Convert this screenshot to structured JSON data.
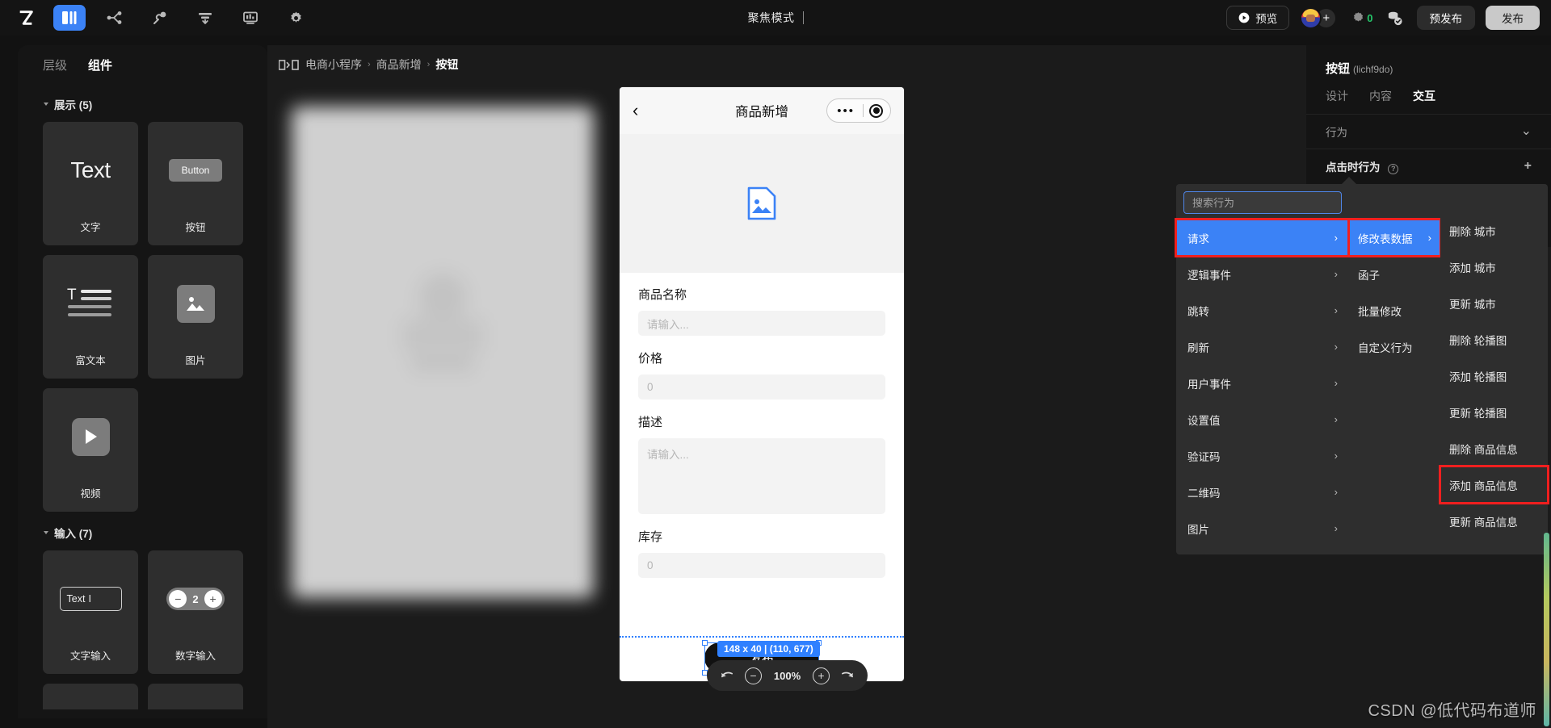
{
  "topbar": {
    "logo": "Z",
    "icons": [
      {
        "name": "pages-icon",
        "active": true
      },
      {
        "name": "flow-icon",
        "active": false
      },
      {
        "name": "plugin-icon",
        "active": false
      },
      {
        "name": "data-table-icon",
        "active": false
      },
      {
        "name": "dashboard-icon",
        "active": false
      },
      {
        "name": "settings-icon",
        "active": false
      }
    ],
    "focus_mode": "聚焦模式",
    "preview_label": "预览",
    "coin_count": "0",
    "prepublish_label": "预发布",
    "publish_label": "发布"
  },
  "left_panel": {
    "tabs": [
      {
        "label": "层级",
        "active": false
      },
      {
        "label": "组件",
        "active": true
      }
    ],
    "groups": [
      {
        "title": "展示 (5)",
        "items": [
          {
            "label": "文字",
            "visual": "Text"
          },
          {
            "label": "按钮",
            "visual": "Button"
          },
          {
            "label": "富文本",
            "visual": "richtext"
          },
          {
            "label": "图片",
            "visual": "image"
          },
          {
            "label": "视频",
            "visual": "video"
          }
        ]
      },
      {
        "title": "输入 (7)",
        "items": [
          {
            "label": "文字输入",
            "visual": "Text"
          },
          {
            "label": "数字输入",
            "visual": "2"
          }
        ]
      }
    ]
  },
  "canvas": {
    "breadcrumb": {
      "icon": "page-flow-icon",
      "parts": [
        "电商小程序",
        "商品新增",
        "按钮"
      ],
      "separator": "›"
    },
    "phone": {
      "nav_title": "商品新增",
      "back_icon": "chevron-left-icon",
      "capsule": {
        "more": "•••",
        "target": "target-icon"
      },
      "image_placeholder_icon": "image-file-icon",
      "fields": [
        {
          "label": "商品名称",
          "placeholder": "请输入...",
          "type": "input"
        },
        {
          "label": "价格",
          "placeholder": "0",
          "type": "input"
        },
        {
          "label": "描述",
          "placeholder": "请输入...",
          "type": "textarea"
        },
        {
          "label": "库存",
          "placeholder": "0",
          "type": "input"
        }
      ],
      "publish_button": "发布"
    },
    "selection_tip": "148 x 40 | (110, 677)",
    "zoom": {
      "undo_icon": "undo-icon",
      "minus": "−",
      "percent": "100%",
      "plus": "+",
      "redo_icon": "redo-icon"
    }
  },
  "right_panel": {
    "component_name": "按钮",
    "component_id": "(lichf9do)",
    "tabs": [
      {
        "label": "设计",
        "active": false
      },
      {
        "label": "内容",
        "active": false
      },
      {
        "label": "交互",
        "active": true
      }
    ],
    "section_label": "行为",
    "section_collapse_icon": "chevron-up-icon",
    "row_label": "点击时行为",
    "row_help_icon": "help-icon",
    "row_add_icon": "+"
  },
  "dropdown": {
    "search_placeholder": "搜索行为",
    "column1": [
      {
        "label": "请求",
        "has_children": true,
        "selected": true,
        "highlighted": true
      },
      {
        "label": "逻辑事件",
        "has_children": true,
        "selected": false,
        "highlighted": false
      },
      {
        "label": "跳转",
        "has_children": true,
        "selected": false,
        "highlighted": false
      },
      {
        "label": "刷新",
        "has_children": true,
        "selected": false,
        "highlighted": false
      },
      {
        "label": "用户事件",
        "has_children": true,
        "selected": false,
        "highlighted": false
      },
      {
        "label": "设置值",
        "has_children": true,
        "selected": false,
        "highlighted": false
      },
      {
        "label": "验证码",
        "has_children": true,
        "selected": false,
        "highlighted": false
      },
      {
        "label": "二维码",
        "has_children": true,
        "selected": false,
        "highlighted": false
      },
      {
        "label": "图片",
        "has_children": true,
        "selected": false,
        "highlighted": false
      }
    ],
    "column2": [
      {
        "label": "修改表数据",
        "has_children": true,
        "selected": true,
        "highlighted": true
      },
      {
        "label": "函子",
        "has_children": false,
        "selected": false,
        "highlighted": false
      },
      {
        "label": "批量修改",
        "has_children": false,
        "selected": false,
        "highlighted": false
      },
      {
        "label": "自定义行为",
        "has_children": false,
        "selected": false,
        "highlighted": false
      }
    ],
    "column3": [
      {
        "label": "删除 城市",
        "highlighted": false
      },
      {
        "label": "添加 城市",
        "highlighted": false
      },
      {
        "label": "更新 城市",
        "highlighted": false
      },
      {
        "label": "删除 轮播图",
        "highlighted": false
      },
      {
        "label": "添加 轮播图",
        "highlighted": false
      },
      {
        "label": "更新 轮播图",
        "highlighted": false
      },
      {
        "label": "删除 商品信息",
        "highlighted": false
      },
      {
        "label": "添加 商品信息",
        "highlighted": true
      },
      {
        "label": "更新 商品信息",
        "highlighted": false
      }
    ]
  },
  "watermark": "CSDN @低代码布道师",
  "colors": {
    "accent_blue": "#3b82f6",
    "highlight_red": "#f01f1f",
    "publish_grey": "#c9c9c9",
    "coin_green": "#25c76a"
  }
}
